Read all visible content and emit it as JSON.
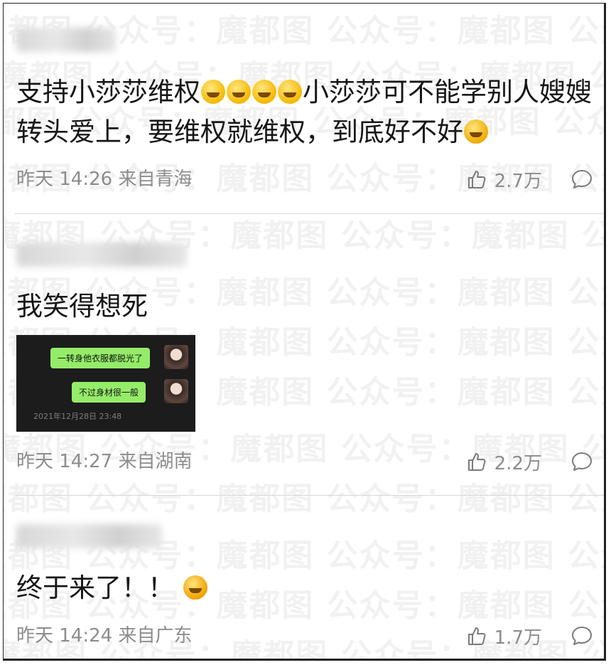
{
  "watermark": {
    "text": "魔都图 公众号：魔都图 公众号：魔都图 公众号：魔都图"
  },
  "comments": [
    {
      "text_part1": "支持小莎莎维权",
      "text_part2": "小莎莎可不能学别人嫂嫂转头爱上，要维权就维权，到底好不好",
      "meta": "昨天 14:26 来自青海",
      "likes": "2.7万",
      "emoji_count": 4
    },
    {
      "text": "我笑得想死",
      "meta": "昨天 14:27 来自湖南",
      "likes": "2.2万",
      "image": {
        "bubble1": "一转身他衣服都脱光了",
        "bubble2": "不过身材很一般",
        "timestamp": "2021年12月28日 23:48"
      }
    },
    {
      "text": "终于来了！！",
      "meta": "昨天 14:24 来自广东",
      "likes": "1.7万"
    }
  ],
  "icons": {
    "like": "thumbs-up-icon",
    "reply": "comment-bubble-icon",
    "emoji": "crying-face-emoji"
  }
}
